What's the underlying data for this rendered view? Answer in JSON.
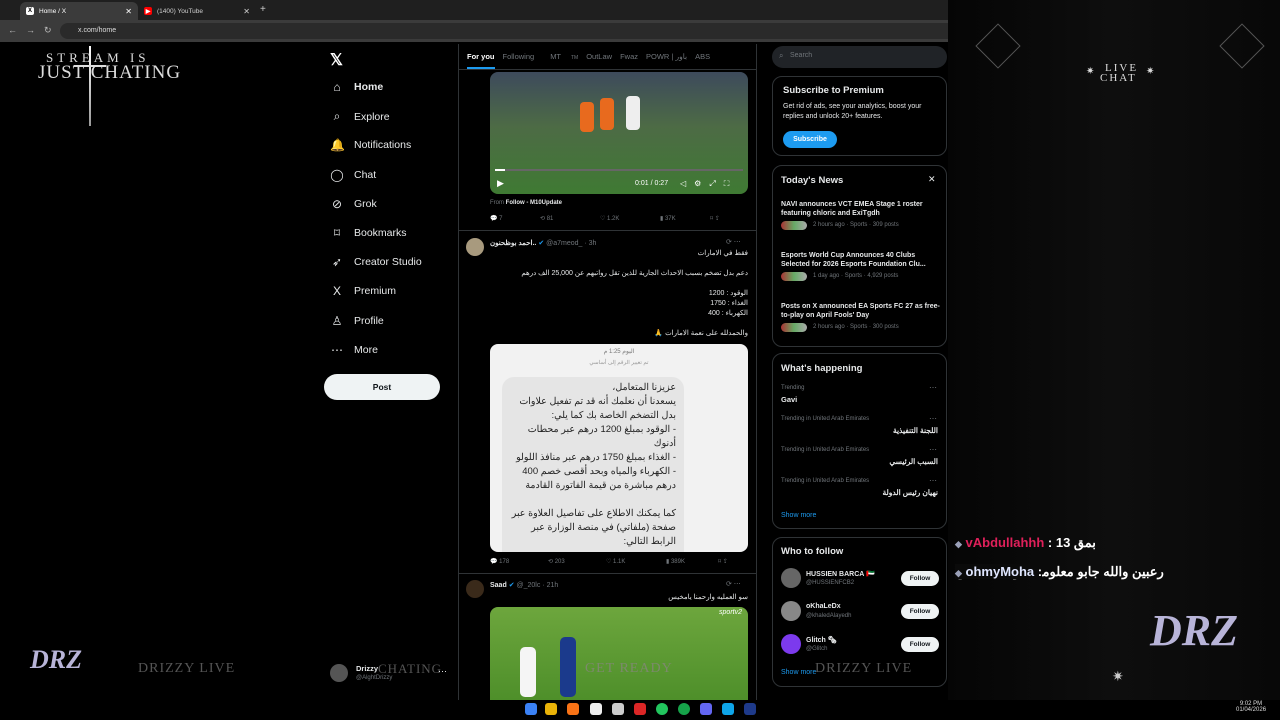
{
  "browser": {
    "tabs": [
      {
        "label": "Home / X",
        "active": true
      },
      {
        "label": "(1400) YouTube",
        "active": false
      }
    ],
    "url": "x.com/home"
  },
  "overlay": {
    "logo_line1": "STREAM IS",
    "logo_line2": "JUST CHATING",
    "live_chat_line1": "LIVE",
    "live_chat_line2": "CHAT",
    "watermark_left": "DRIZZY LIVE",
    "watermark_right": "DRIZZY LIVE",
    "watermark_center": "GET READY",
    "watermark_chating": "CHATING",
    "drz_logo": "DRZ",
    "chat_messages": [
      {
        "user": "vAbdullahhh",
        "text": "بمق 13"
      },
      {
        "user": "ohmyMoha",
        "text": "رعبين والله جابو معلوماته بوقت قياسي"
      }
    ]
  },
  "sidebar": {
    "items": [
      {
        "label": "Home",
        "icon": "home-icon",
        "glyph": "⌂"
      },
      {
        "label": "Explore",
        "icon": "search-icon",
        "glyph": "⌕"
      },
      {
        "label": "Notifications",
        "icon": "bell-icon",
        "glyph": "🔔"
      },
      {
        "label": "Chat",
        "icon": "chat-icon",
        "glyph": "◯"
      },
      {
        "label": "Grok",
        "icon": "grok-icon",
        "glyph": "⊘"
      },
      {
        "label": "Bookmarks",
        "icon": "bookmark-icon",
        "glyph": "⌑"
      },
      {
        "label": "Creator Studio",
        "icon": "rocket-icon",
        "glyph": "➶"
      },
      {
        "label": "Premium",
        "icon": "x-logo-icon",
        "glyph": "X"
      },
      {
        "label": "Profile",
        "icon": "person-icon",
        "glyph": "♙"
      },
      {
        "label": "More",
        "icon": "more-icon",
        "glyph": "⋯"
      }
    ],
    "post_label": "Post",
    "account": {
      "name": "Drizzy",
      "handle": "@AlghtDrizzy"
    }
  },
  "timeline": {
    "tabs": [
      "For you",
      "Following",
      "MT",
      "OutLaw",
      "Fwaz",
      "POWR | باور",
      "ABS"
    ],
    "mt_suffix": "TM",
    "video": {
      "time": "0:01 / 0:27"
    },
    "from_label": "From",
    "from_source": "Follow - M10Update",
    "tweet0_stats": {
      "replies": "7",
      "retweets": "81",
      "likes": "1.2K",
      "views": "37K"
    },
    "tweet1": {
      "name": "احمد بوظحنون..",
      "handle": "@a7meod_",
      "time": "· 3h",
      "line1": "فقط في الامارات",
      "line2": "دعم بدل تضخم بسبب الاحداث الجارية للذين تقل رواتبهم عن 25,000 الف درهم",
      "line3": "الوقود : 1200",
      "line4": "الغذاء : 1750",
      "line5": "الكهرباء : 400",
      "line6": "والحمدلله على نعمة الامارات 🙏",
      "card_header": "اليوم 1:25 م",
      "card_sub": "تم تغيير الرقم إلى أساسي",
      "card_body": "عزيزنا المتعامل،\nيسعدنا أن نعلمك أنه قد تم تفعيل علاوات بدل التضخم الخاصة بك كما يلي:\n- الوقود بمبلغ 1200 درهم عبر محطات أدنوك\n- الغذاء بمبلغ 1750 درهم عبر منافذ اللولو\n- الكهرباء والمياه وبحد أقصى خصم 400 درهم مباشرة من قيمة الفاتورة القادمة\n\nكما يمكنك الاطلاع على تفاصيل العلاوة عبر صفحة (ملفاتي) في منصة الوزارة عبر الرابط التالي:",
      "stats": {
        "replies": "178",
        "retweets": "203",
        "likes": "1.1K",
        "views": "389K"
      }
    },
    "tweet2": {
      "name": "Saad",
      "handle": "@_20lc",
      "time": "· 21h",
      "text": "سو العمليه وارحمنا يامخيس",
      "channel": "sportv2"
    }
  },
  "right": {
    "search_placeholder": "Search",
    "premium": {
      "title": "Subscribe to Premium",
      "text": "Get rid of ads, see your analytics, boost your replies and unlock 20+ features.",
      "button": "Subscribe"
    },
    "news": {
      "title": "Today's News",
      "items": [
        {
          "title": "NAVI announces VCT EMEA Stage 1 roster featuring chloric and ExiTgdh",
          "meta": "2 hours ago · Sports · 309 posts"
        },
        {
          "title": "Esports World Cup Announces 40 Clubs Selected for 2026 Esports Foundation Clu...",
          "meta": "1 day ago · Sports · 4,929 posts"
        },
        {
          "title": "Posts on X announced EA Sports FC 27 as free-to-play on April Fools' Day",
          "meta": "2 hours ago · Sports · 300 posts"
        }
      ]
    },
    "happening": {
      "title": "What's happening",
      "items": [
        {
          "meta": "Trending",
          "title": "Gavi"
        },
        {
          "meta": "Trending in United Arab Emirates",
          "title": "اللجنة التنفيذية"
        },
        {
          "meta": "Trending in United Arab Emirates",
          "title": "السبب الرئيسي"
        },
        {
          "meta": "Trending in United Arab Emirates",
          "title": "نهيان رئيس الدولة"
        }
      ],
      "show_more": "Show more"
    },
    "follow": {
      "title": "Who to follow",
      "items": [
        {
          "name": "HUSSIEN BARCA 🇦🇪",
          "handle": "@HUSSIENFCB2"
        },
        {
          "name": "oKhaLeDx",
          "handle": "@khaledAlayedh"
        },
        {
          "name": "Glitch 🗞",
          "handle": "@Glitch"
        }
      ],
      "button": "Follow",
      "show_more": "Show more"
    }
  },
  "clock": {
    "time": "9:02 PM",
    "date": "01/04/2026"
  }
}
